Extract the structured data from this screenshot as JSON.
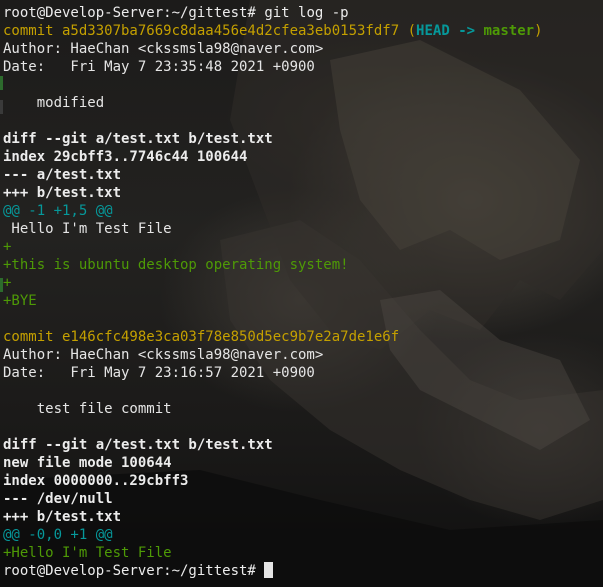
{
  "terminal": {
    "prompt": "root@Develop-Server:~/gittest#",
    "command": "git log -p",
    "commits": [
      {
        "hash_line": "commit a5d3307ba7669c8daa456e4d2cfea3eb0153fdf7",
        "ref_open": "(",
        "head": "HEAD",
        "arrow": "->",
        "branch": "master",
        "ref_close": ")",
        "author": "Author: HaeChan <ckssmsla98@naver.com>",
        "date": "Date:   Fri May 7 23:35:48 2021 +0900",
        "message": "    modified",
        "diff_header": "diff --git a/test.txt b/test.txt",
        "index": "index 29cbff3..7746c44 100644",
        "minus_file": "--- a/test.txt",
        "plus_file": "+++ b/test.txt",
        "hunk": "@@ -1 +1,5 @@",
        "lines": [
          {
            "type": "context",
            "text": " Hello I'm Test File"
          },
          {
            "type": "add",
            "text": "+"
          },
          {
            "type": "add",
            "text": "+this is ubuntu desktop operating system!"
          },
          {
            "type": "add",
            "text": "+"
          },
          {
            "type": "add",
            "text": "+BYE"
          }
        ]
      },
      {
        "hash_line": "commit e146cfc498e3ca03f78e850d5ec9b7e2a7de1e6f",
        "author": "Author: HaeChan <ckssmsla98@naver.com>",
        "date": "Date:   Fri May 7 23:16:57 2021 +0900",
        "message": "    test file commit",
        "diff_header": "diff --git a/test.txt b/test.txt",
        "new_file_mode": "new file mode 100644",
        "index": "index 0000000..29cbff3",
        "minus_file": "--- /dev/null",
        "plus_file": "+++ b/test.txt",
        "hunk": "@@ -0,0 +1 @@",
        "lines": [
          {
            "type": "add",
            "text": "+Hello I'm Test File"
          }
        ]
      }
    ],
    "final_prompt": "root@Develop-Server:~/gittest#"
  },
  "colors": {
    "commit_hash": "#c4a000",
    "head": "#06989a",
    "branch": "#4e9a06",
    "hunk": "#06989a",
    "added": "#4e9a06",
    "text": "#e5e5e5"
  }
}
